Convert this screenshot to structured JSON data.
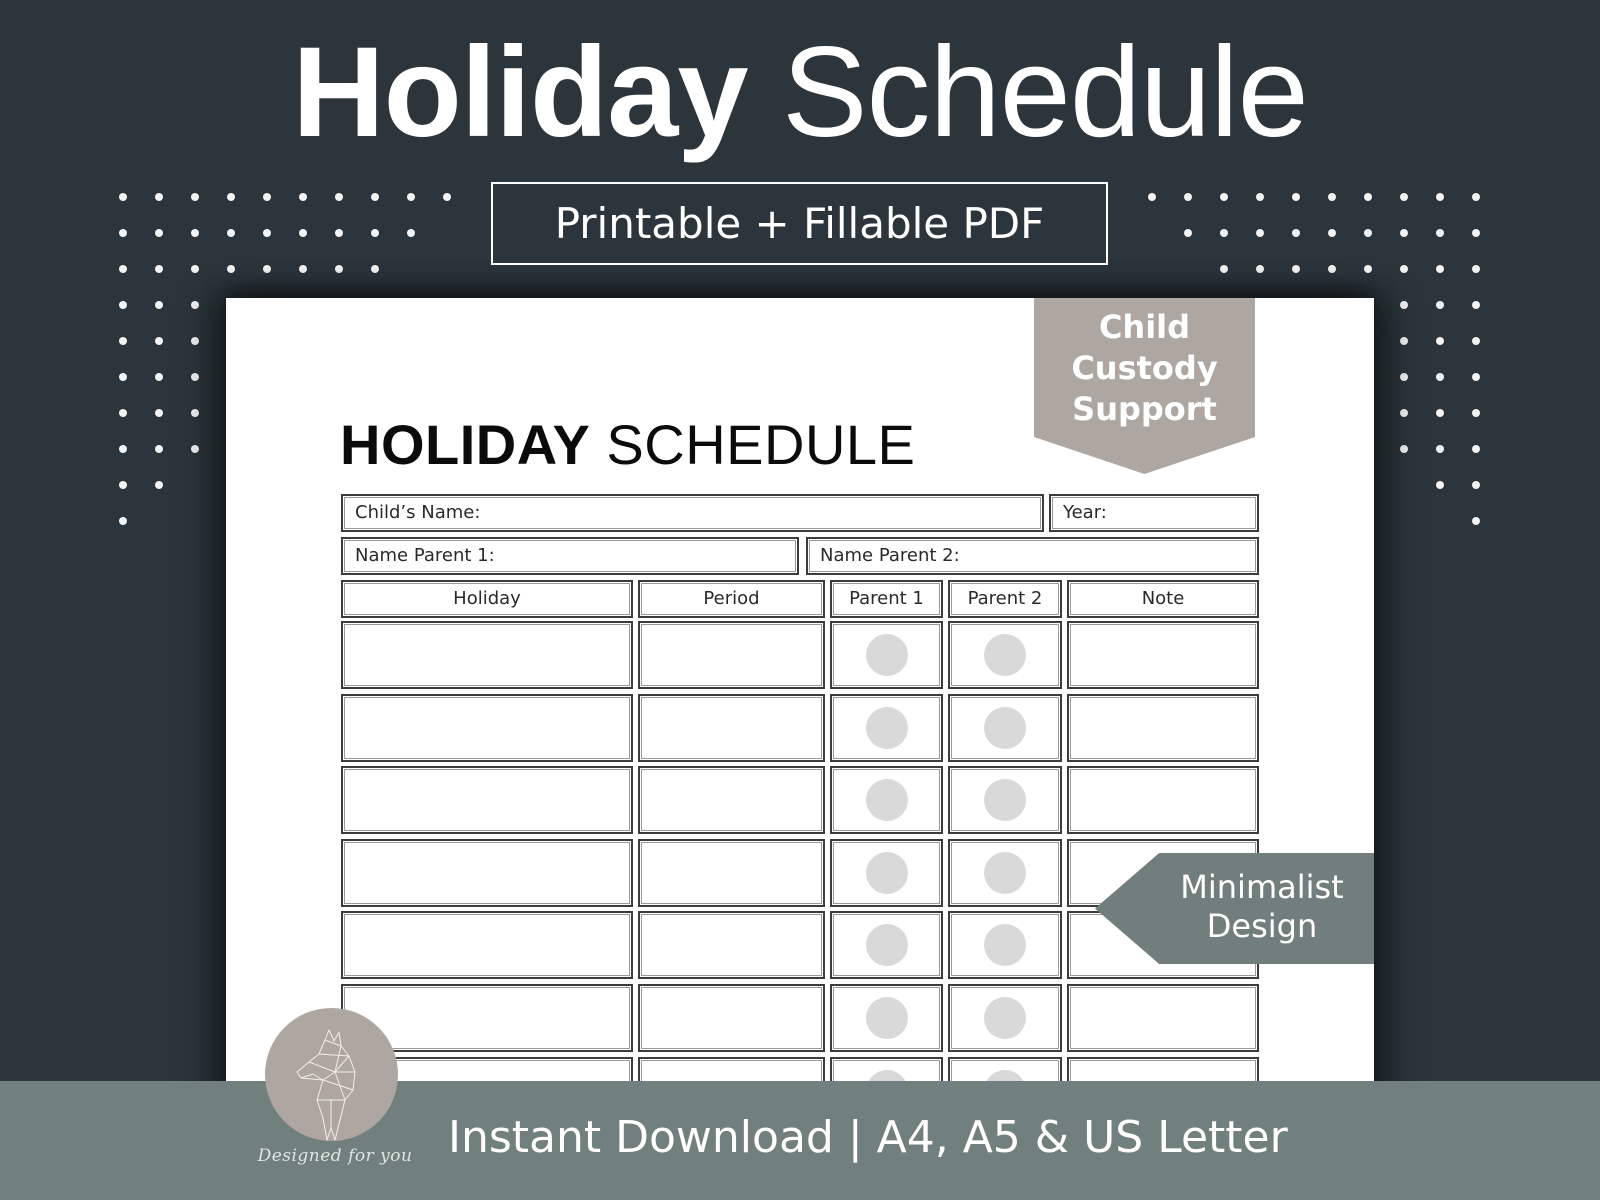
{
  "header": {
    "title_bold": "Holiday",
    "title_light": "Schedule",
    "subtitle": "Printable + Fillable PDF"
  },
  "sheet": {
    "title_bold": "HOLIDAY",
    "title_light": "SCHEDULE",
    "fields": {
      "child_name": "Child’s Name:",
      "year": "Year:",
      "parent1": "Name Parent 1:",
      "parent2": "Name Parent 2:"
    },
    "columns": [
      "Holiday",
      "Period",
      "Parent 1",
      "Parent 2",
      "Note"
    ],
    "row_count": 7
  },
  "badges": {
    "custody": [
      "Child",
      "Custody",
      "Support"
    ],
    "minimal": [
      "Minimalist",
      "Design"
    ]
  },
  "footer": {
    "text": "Instant Download | A4, A5 & US Letter",
    "logo_caption": "Designed for you"
  },
  "colors": {
    "background": "#2b353b",
    "paper": "#ffffff",
    "custody_badge": "#aea6a0",
    "minimal_badge": "#727e7c",
    "footer": "#717f7d",
    "radio": "#d9d9d9"
  }
}
